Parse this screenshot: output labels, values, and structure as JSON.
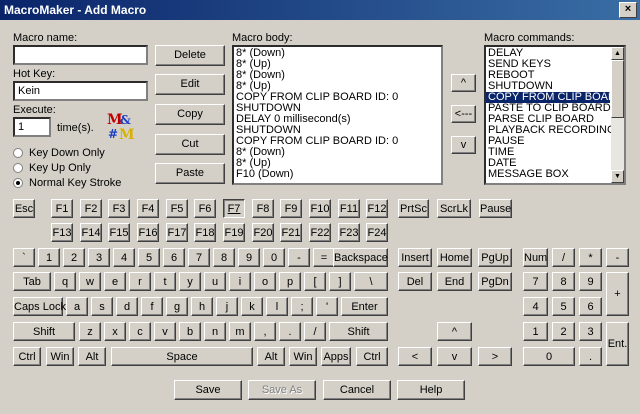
{
  "window": {
    "title": "MacroMaker - Add Macro",
    "close_glyph": "×"
  },
  "left": {
    "macro_name_label": "Macro name:",
    "macro_name_value": "",
    "hotkey_label": "Hot Key:",
    "hotkey_value": "Kein",
    "execute_label": "Execute:",
    "execute_value": "1",
    "times_label": "time(s).",
    "radios": [
      {
        "label": "Key Down Only",
        "checked": false
      },
      {
        "label": "Key Up Only",
        "checked": false
      },
      {
        "label": "Normal Key Stroke",
        "checked": true
      }
    ]
  },
  "actions": {
    "delete": "Delete",
    "edit": "Edit",
    "copy": "Copy",
    "cut": "Cut",
    "paste": "Paste"
  },
  "macro_body": {
    "label": "Macro body:",
    "lines": [
      "8* (Down)",
      "8* (Up)",
      "8* (Down)",
      "8* (Up)",
      "COPY FROM CLIP BOARD ID: 0",
      "SHUTDOWN",
      "DELAY 0 millisecond(s)",
      "SHUTDOWN",
      "COPY FROM CLIP BOARD ID: 0",
      "8* (Down)",
      "8* (Up)",
      "F10 (Down)"
    ]
  },
  "move": {
    "up": "^",
    "left": "<---",
    "down": "v"
  },
  "commands": {
    "label": "Macro commands:",
    "items": [
      "DELAY",
      "SEND KEYS",
      "REBOOT",
      "SHUTDOWN",
      "COPY FROM CLIP BOARD",
      "PASTE TO CLIP BOARD",
      "PARSE CLIP BOARD",
      "PLAYBACK RECORDING",
      "PAUSE",
      "TIME",
      "DATE",
      "MESSAGE BOX"
    ],
    "selected_index": 4
  },
  "keyboard": {
    "fn_row": [
      "Esc",
      "F1",
      "F2",
      "F3",
      "F4",
      "F5",
      "F6",
      "F7",
      "F8",
      "F9",
      "F10",
      "F11",
      "F12"
    ],
    "fn_row2": [
      "F13",
      "F14",
      "F15",
      "F16",
      "F17",
      "F18",
      "F19",
      "F20",
      "F21",
      "F22",
      "F23",
      "F24"
    ],
    "sys_keys": [
      "PrtSc",
      "ScrLk",
      "Pause"
    ],
    "pressed": "F7",
    "row1": [
      "`",
      "1",
      "2",
      "3",
      "4",
      "5",
      "6",
      "7",
      "8",
      "9",
      "0",
      "-",
      "=",
      "Backspace"
    ],
    "row2": [
      "Tab",
      "q",
      "w",
      "e",
      "r",
      "t",
      "y",
      "u",
      "i",
      "o",
      "p",
      "[",
      "]",
      "\\"
    ],
    "row3": [
      "Caps Lock",
      "a",
      "s",
      "d",
      "f",
      "g",
      "h",
      "j",
      "k",
      "l",
      ";",
      "'",
      "Enter"
    ],
    "row4": [
      "Shift",
      "z",
      "x",
      "c",
      "v",
      "b",
      "n",
      "m",
      ",",
      ".",
      "/",
      "Shift"
    ],
    "row5": [
      "Ctrl",
      "Win",
      "Alt",
      "Space",
      "Alt",
      "Win",
      "Apps",
      "Ctrl"
    ],
    "nav": [
      "Insert",
      "Home",
      "PgUp",
      "Del",
      "End",
      "PgDn"
    ],
    "arrows": [
      "^",
      "<",
      "v",
      ">"
    ],
    "numpad": [
      "Num",
      "/",
      "*",
      "-",
      "7",
      "8",
      "9",
      "+",
      "4",
      "5",
      "6",
      "1",
      "2",
      "3",
      "Ent.",
      "0",
      "."
    ]
  },
  "footer": {
    "save": "Save",
    "save_as": "Save As",
    "cancel": "Cancel",
    "help": "Help"
  }
}
